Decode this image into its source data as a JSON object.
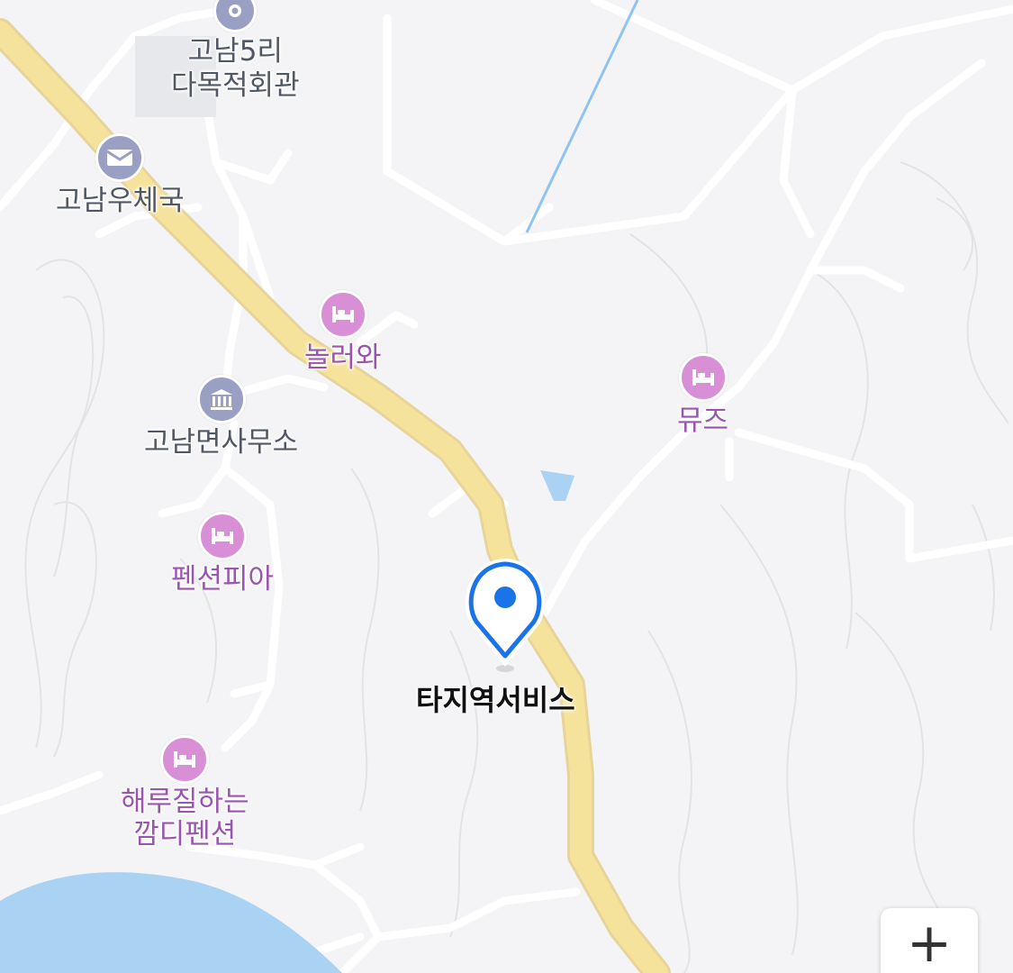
{
  "map": {
    "places": [
      {
        "id": "gonam5ri",
        "name_line1": "고남5리",
        "name_line2": "다목적회관",
        "category": "community-hall",
        "icon": "location-dot-icon"
      },
      {
        "id": "post",
        "name": "고남우체국",
        "category": "post-office",
        "icon": "mail-icon"
      },
      {
        "id": "nollowa",
        "name": "놀러와",
        "category": "lodging",
        "icon": "bed-icon"
      },
      {
        "id": "office",
        "name": "고남면사무소",
        "category": "government-office",
        "icon": "building-icon"
      },
      {
        "id": "muse",
        "name": "뮤즈",
        "category": "lodging",
        "icon": "bed-icon"
      },
      {
        "id": "pia",
        "name": "펜션피아",
        "category": "lodging",
        "icon": "bed-icon"
      },
      {
        "id": "kkamdi",
        "name_line1": "해루질하는",
        "name_line2": "깜디펜션",
        "category": "lodging",
        "icon": "bed-icon"
      }
    ],
    "selected": {
      "name": "타지역서비스",
      "icon": "selected-location-pin-icon"
    },
    "controls": {
      "zoom_in": "+"
    },
    "colors": {
      "land": "#f4f4f6",
      "road_major": "#f5e096",
      "road_minor": "#ffffff",
      "water": "#a9d2f3",
      "marker": "#1a73e8",
      "lodging": "#d98fd6",
      "public": "#9aa0c4"
    }
  }
}
